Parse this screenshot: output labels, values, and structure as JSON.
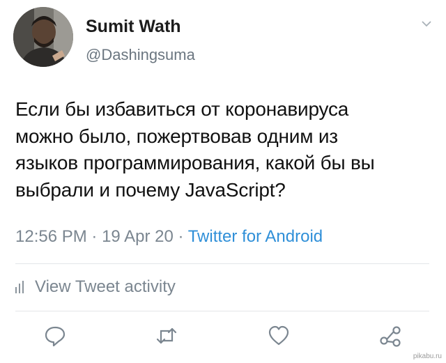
{
  "user": {
    "name": "Sumit Wath",
    "handle": "@Dashingsuma"
  },
  "tweet": {
    "lines": [
      "Если бы избавиться от коронавируса",
      "можно было, пожертвовав одним из",
      "языков программирования, какой бы вы",
      "выбрали и почему JavaScript?"
    ]
  },
  "meta": {
    "time": "12:56 PM",
    "sep1": " · ",
    "date": "19 Apr 20",
    "sep2": " · ",
    "client": "Twitter for Android"
  },
  "activity": {
    "label": "View Tweet activity"
  },
  "actions": {
    "icons": [
      "reply-icon",
      "retweet-icon",
      "like-icon",
      "share-icon"
    ]
  },
  "watermark": "pikabu.ru",
  "colors": {
    "link": "#2f8fd8",
    "secondary_text": "#7b8690",
    "icon": "#7b8690"
  }
}
